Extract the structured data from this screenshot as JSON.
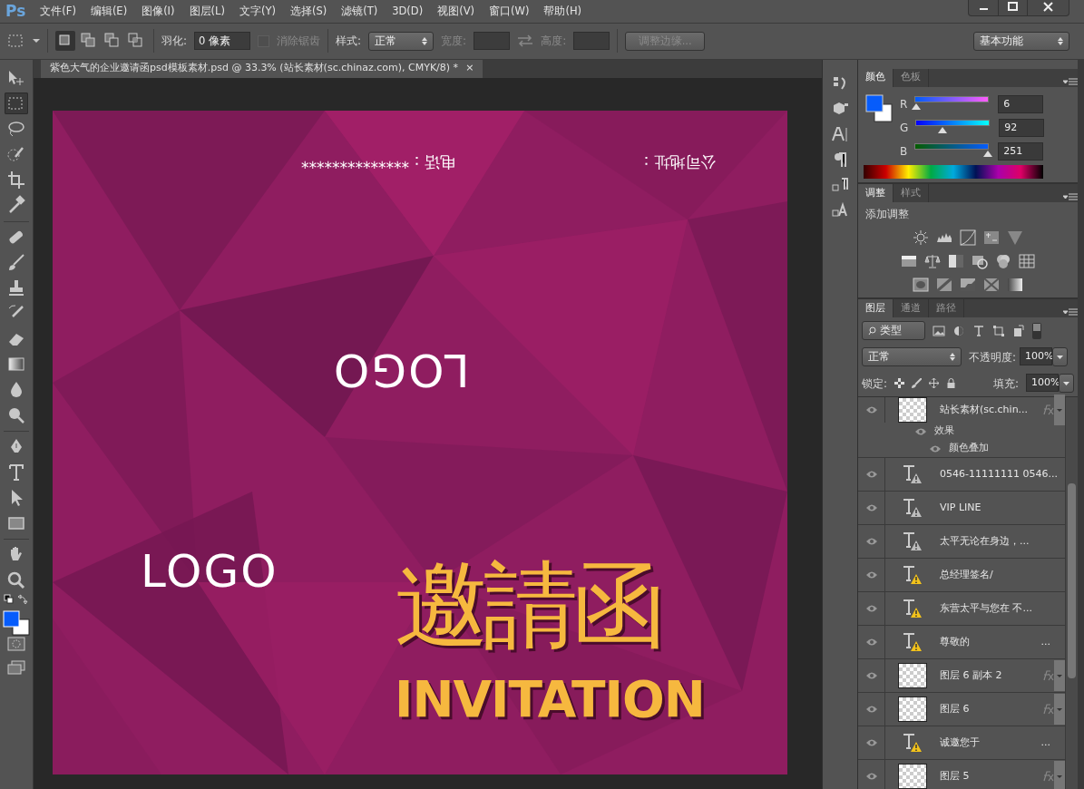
{
  "app": {
    "logo": "Ps"
  },
  "menu": [
    "文件(F)",
    "编辑(E)",
    "图像(I)",
    "图层(L)",
    "文字(Y)",
    "选择(S)",
    "滤镜(T)",
    "3D(D)",
    "视图(V)",
    "窗口(W)",
    "帮助(H)"
  ],
  "options_bar": {
    "feather_label": "羽化:",
    "feather_value": "0 像素",
    "antialias": {
      "label": "消除锯齿",
      "checked": false,
      "disabled": true
    },
    "style_label": "样式:",
    "style_value": "正常",
    "width_label": "宽度:",
    "height_label": "高度:",
    "refine_button": "调整边缘...",
    "workspace": "基本功能",
    "modes": [
      {
        "selected": true
      },
      {
        "selected": false
      },
      {
        "selected": false
      },
      {
        "selected": false
      }
    ]
  },
  "document_tab": {
    "title": "紫色大气的企业邀请函psd模板素材.psd @ 33.3% (站长素材(sc.chinaz.com), CMYK/8) *",
    "close": "×"
  },
  "tools": [
    {
      "selected": false
    },
    {
      "selected": true
    },
    {
      "selected": false
    },
    {
      "selected": false
    },
    {
      "selected": false
    },
    {
      "selected": false
    },
    {
      "selected": false
    },
    {
      "selected": false
    },
    {
      "selected": false
    },
    {
      "selected": false
    },
    {
      "selected": false
    },
    {
      "selected": false
    },
    {
      "selected": false
    },
    {
      "selected": false
    },
    {
      "selected": false
    },
    {
      "selected": false
    },
    {
      "selected": false
    },
    {
      "selected": false
    },
    {
      "selected": false
    },
    {
      "selected": false
    }
  ],
  "canvas": {
    "phone_flipped": "电话：**************",
    "address_flipped": "公司地址：",
    "logo_flipped": "LOGO",
    "logo": "LOGO",
    "title_cn": "邀請函",
    "title_en": "INVITATION"
  },
  "color_panel": {
    "tabs": [
      {
        "label": "颜色",
        "selected": true
      },
      {
        "label": "色板",
        "selected": false
      }
    ],
    "channels": [
      {
        "label": "R",
        "value": "6",
        "level": 0.024
      },
      {
        "label": "G",
        "value": "92",
        "level": 0.36
      },
      {
        "label": "B",
        "value": "251",
        "level": 0.984
      }
    ]
  },
  "adjustments_panel": {
    "tabs": [
      {
        "label": "调整",
        "selected": true
      },
      {
        "label": "样式",
        "selected": false
      }
    ],
    "heading": "添加调整"
  },
  "layers_panel": {
    "tabs": [
      {
        "label": "图层",
        "selected": true
      },
      {
        "label": "通道",
        "selected": false
      },
      {
        "label": "路径",
        "selected": false
      }
    ],
    "filter": "类型",
    "blend_mode": "正常",
    "opacity_label": "不透明度:",
    "opacity": "100%",
    "lock_label": "锁定:",
    "fill_label": "填充:",
    "fill": "100%",
    "layers": [
      {
        "kind": "image",
        "name": "站长素材(sc.chin...",
        "visible": true,
        "fx": true,
        "children": [
          {
            "name": "效果",
            "visible": true,
            "children": [
              {
                "name": "颜色叠加",
                "visible": true
              }
            ]
          }
        ]
      },
      {
        "kind": "text",
        "name": "0546-11111111 0546...",
        "visible": true,
        "alert": false
      },
      {
        "kind": "text",
        "name": "VIP LINE",
        "visible": true,
        "alert": false
      },
      {
        "kind": "text",
        "name": "太平无论在身边，...",
        "visible": true,
        "alert": false
      },
      {
        "kind": "text",
        "name": "总经理签名/",
        "visible": true,
        "alert": true
      },
      {
        "kind": "text",
        "name": "东营太平与您在  不...",
        "visible": true,
        "alert": true
      },
      {
        "kind": "text",
        "name": "尊敬的",
        "suffix": "...",
        "visible": true,
        "alert": true
      },
      {
        "kind": "image",
        "name": "图层 6 副本 2",
        "visible": true,
        "fx": true
      },
      {
        "kind": "image",
        "name": "图层 6",
        "visible": true,
        "fx": true
      },
      {
        "kind": "text",
        "name": "诚邀您于",
        "suffix": "...",
        "visible": true,
        "alert": true
      },
      {
        "kind": "image",
        "name": "图层 5",
        "visible": true,
        "fx": true
      }
    ]
  }
}
